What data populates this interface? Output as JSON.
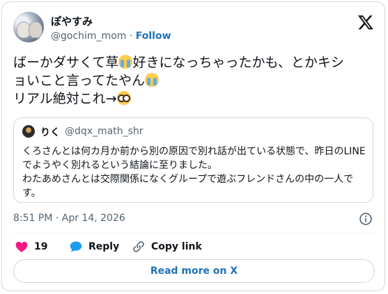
{
  "author": {
    "display_name": "ぽやすみ",
    "handle": "@gochim_mom",
    "separator": "·",
    "follow_label": "Follow"
  },
  "tweet": {
    "line1": "ばーかダサくて草",
    "line1b": "好きになっちゃったかも、とかキシ",
    "line2": "ョいこと言ってたやん",
    "line3": "リアル絶対これ→"
  },
  "quoted": {
    "name": "りく",
    "handle": "@dqx_math_shr",
    "text": "くろさんとは何カ月か前から別の原因で別れ話が出ている状態で、昨日のLINEでようやく別れるという結論に至りました。\nわたあめさんとは交際関係になくグループで遊ぶフレンドさんの中の一人です。"
  },
  "timestamp": "8:51 PM · Apr 14, 2026",
  "actions": {
    "like_count": "19",
    "reply_label": "Reply",
    "copy_label": "Copy link"
  },
  "read_more_label": "Read more on X",
  "colors": {
    "accent": "#1d72b8",
    "heart": "#f91880",
    "secondary_text": "#536471",
    "border": "#cfd9de"
  },
  "icons": [
    "x-logo-icon",
    "loudly-crying-face-emoji",
    "nerd-face-emoji",
    "info-icon",
    "heart-icon",
    "reply-bubble-icon",
    "link-icon"
  ]
}
